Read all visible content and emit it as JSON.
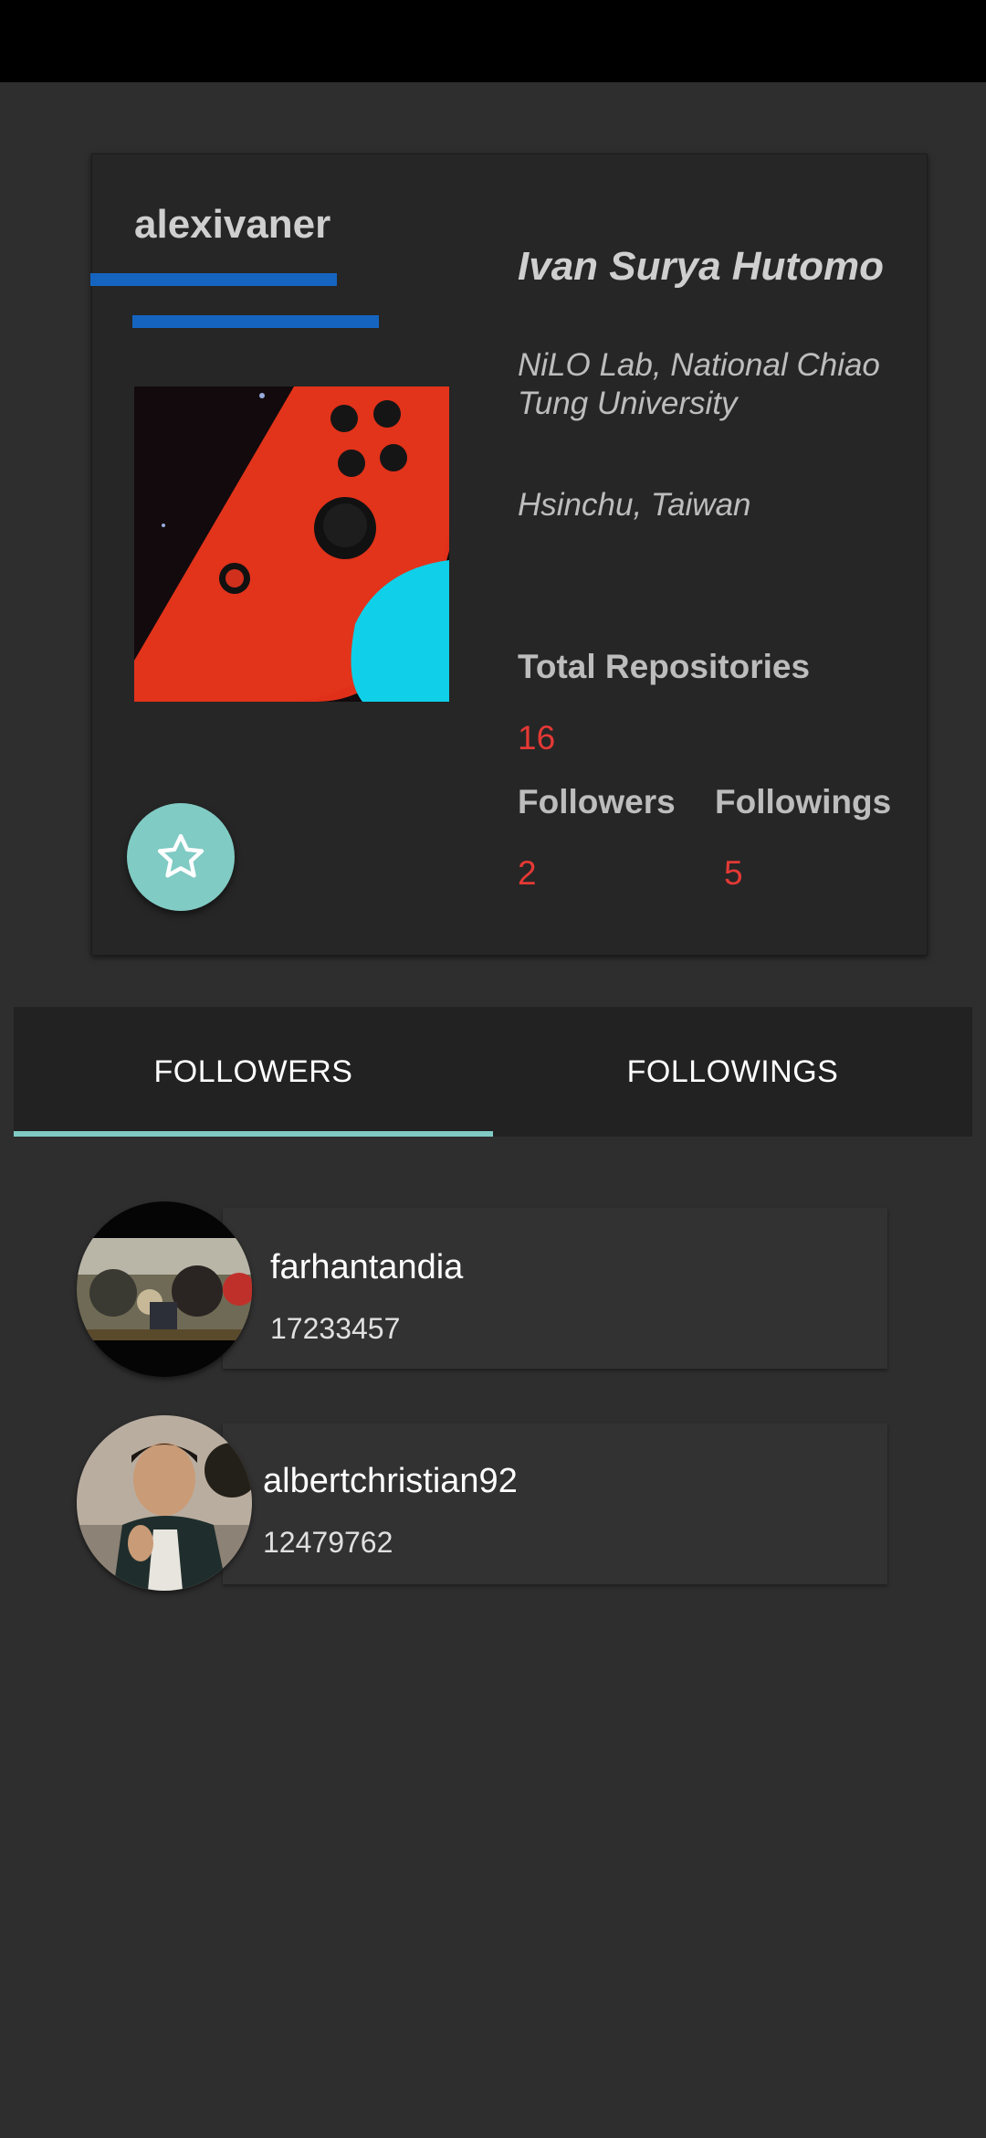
{
  "profile": {
    "username": "alexivaner",
    "full_name": "Ivan Surya Hutomo",
    "company": "NiLO Lab, National Chiao Tung University",
    "location": "Hsinchu, Taiwan",
    "stats": {
      "total_repos_label": "Total Repositories",
      "total_repos": "16",
      "followers_label": "Followers",
      "followers": "2",
      "followings_label": "Followings",
      "followings": "5"
    },
    "fab_icon": "star-outline-icon"
  },
  "tabs": [
    {
      "label": "FOLLOWERS",
      "selected": true
    },
    {
      "label": "FOLLOWINGS",
      "selected": false
    }
  ],
  "followers": [
    {
      "name": "farhantandia",
      "id": "17233457"
    },
    {
      "name": "albertchristian92",
      "id": "12479762"
    }
  ],
  "colors": {
    "background": "#2e2e2e",
    "card": "#262626",
    "accent_blue": "#1565c0",
    "accent_teal": "#80cbc4",
    "value_red": "#e53935"
  }
}
